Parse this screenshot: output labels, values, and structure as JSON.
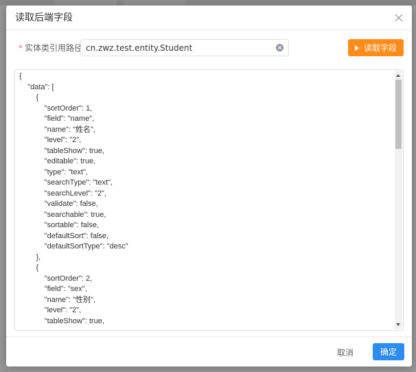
{
  "dialog": {
    "title": "读取后端字段",
    "close_icon": "close-icon"
  },
  "form": {
    "required_mark": "*",
    "path_label": "实体类引用路径",
    "path_value": "cn.zwz.test.entity.Student",
    "read_button_label": "读取字段",
    "read_button_icon": "play-icon",
    "clear_icon": "clear-circle-icon"
  },
  "json_editor": {
    "content": "{\n    \"data\": [\n        {\n            \"sortOrder\": 1,\n            \"field\": \"name\",\n            \"name\": \"姓名\",\n            \"level\": \"2\",\n            \"tableShow\": true,\n            \"editable\": true,\n            \"type\": \"text\",\n            \"searchType\": \"text\",\n            \"searchLevel\": \"2\",\n            \"validate\": false,\n            \"searchable\": true,\n            \"sortable\": false,\n            \"defaultSort\": false,\n            \"defaultSortType\": \"desc\"\n        },\n        {\n            \"sortOrder\": 2,\n            \"field\": \"sex\",\n            \"name\": \"性别\",\n            \"level\": \"2\",\n            \"tableShow\": true,"
  },
  "footer": {
    "cancel_label": "取消",
    "confirm_label": "确定"
  },
  "colors": {
    "primary": "#2d8cf0",
    "warning": "#ff8c1a",
    "required": "#f56c6c"
  }
}
